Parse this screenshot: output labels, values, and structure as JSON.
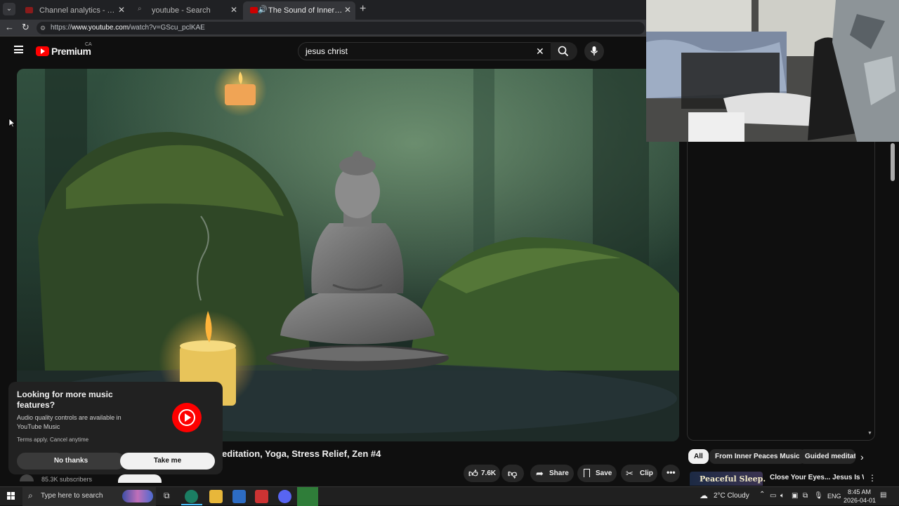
{
  "browser": {
    "tabs": [
      {
        "label": "Channel analytics - YouTube Studio"
      },
      {
        "label": "youtube - Search"
      },
      {
        "label": "The Sound of Inner Peace | Relaxing Music"
      }
    ],
    "new_tab": "+",
    "url_prefix": "https://",
    "url_host": "www.youtube.com",
    "url_path": "/watch?v=GScu_pclKAE"
  },
  "youtube": {
    "logo": "Premium",
    "region": "CA",
    "search_query": "jesus christ"
  },
  "video": {
    "title_visible": "editation, Yoga, Stress Relief, Zen #4",
    "subscribers": "85.3K subscribers",
    "likes": "7.6K",
    "share_label": "Share",
    "save_label": "Save",
    "clip_label": "Clip"
  },
  "chips": [
    "All",
    "From Inner Peaces Music",
    "Guided meditation"
  ],
  "recommendation": {
    "thumb_text": "Peaceful Sleep.",
    "title": "Close Your Eyes... Jesus Is With"
  },
  "popup": {
    "title": "Looking for more music features?",
    "body": "Audio quality controls are available in YouTube Music",
    "terms": "Terms apply. Cancel anytime",
    "no_thanks": "No thanks",
    "take_me": "Take me"
  },
  "taskbar": {
    "search_placeholder": "Type here to search",
    "weather": "2°C  Cloudy",
    "lang": "ENG",
    "time": "8:45 AM",
    "date": "2026-04-01"
  },
  "colors": {
    "yt_red": "#ff0000",
    "background": "#0f0f0f",
    "chip_bg": "#272727"
  }
}
